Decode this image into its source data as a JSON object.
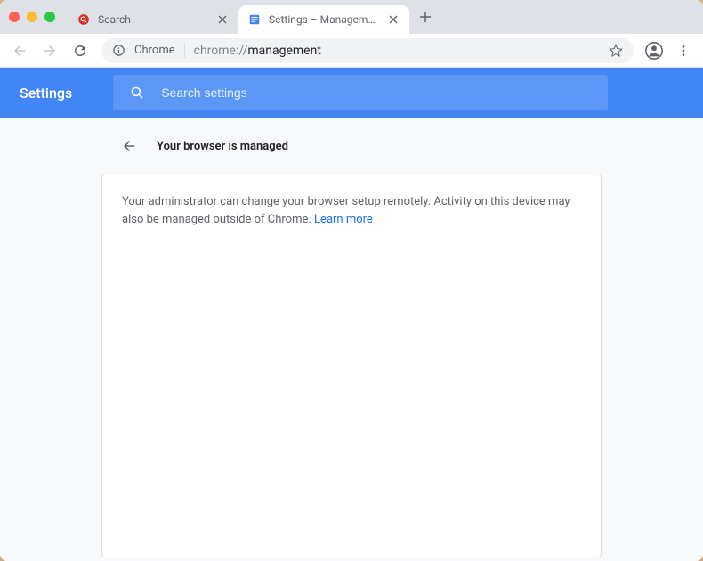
{
  "tabs": [
    {
      "title": "Search",
      "favicon": "search-red"
    },
    {
      "title": "Settings – Management",
      "favicon": "settings-blue"
    }
  ],
  "omnibox": {
    "proto_label": "Chrome",
    "url_prefix": "chrome://",
    "url_path": "management"
  },
  "settings": {
    "title": "Settings",
    "search_placeholder": "Search settings"
  },
  "panel": {
    "title": "Your browser is managed",
    "body": "Your administrator can change your browser setup remotely. Activity on this device may also be managed outside of Chrome. ",
    "link_text": "Learn more"
  }
}
